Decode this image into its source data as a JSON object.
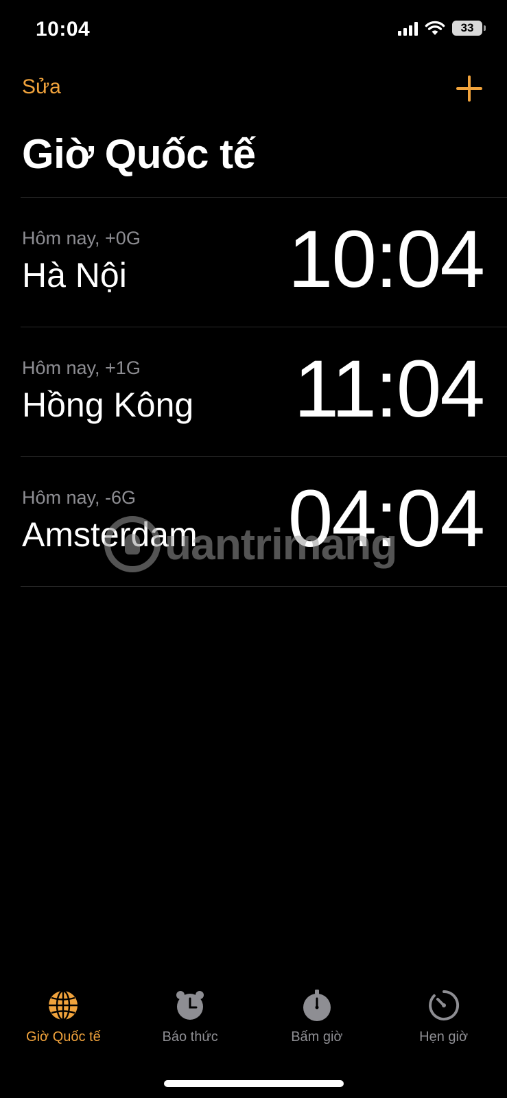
{
  "status_bar": {
    "time": "10:04",
    "battery": "33",
    "icons": [
      "cellular-signal-icon",
      "wifi-icon",
      "battery-icon"
    ]
  },
  "nav": {
    "edit_label": "Sửa",
    "add_icon": "plus-icon"
  },
  "page": {
    "title": "Giờ Quốc tế"
  },
  "clocks": [
    {
      "offset": "Hôm nay, +0G",
      "city": "Hà Nội",
      "time": "10:04"
    },
    {
      "offset": "Hôm nay, +1G",
      "city": "Hồng Kông",
      "time": "11:04"
    },
    {
      "offset": "Hôm nay, -6G",
      "city": "Amsterdam",
      "time": "04:04"
    }
  ],
  "watermark": {
    "text": "uantrimang"
  },
  "tabs": [
    {
      "label": "Giờ Quốc tế",
      "icon": "globe-icon",
      "active": true
    },
    {
      "label": "Báo thức",
      "icon": "alarm-clock-icon",
      "active": false
    },
    {
      "label": "Bấm giờ",
      "icon": "stopwatch-icon",
      "active": false
    },
    {
      "label": "Hẹn giờ",
      "icon": "timer-icon",
      "active": false
    }
  ],
  "colors": {
    "accent": "#f1a33c",
    "background": "#000000",
    "secondary_text": "#8e8e93",
    "separator": "#2a2a2a"
  }
}
